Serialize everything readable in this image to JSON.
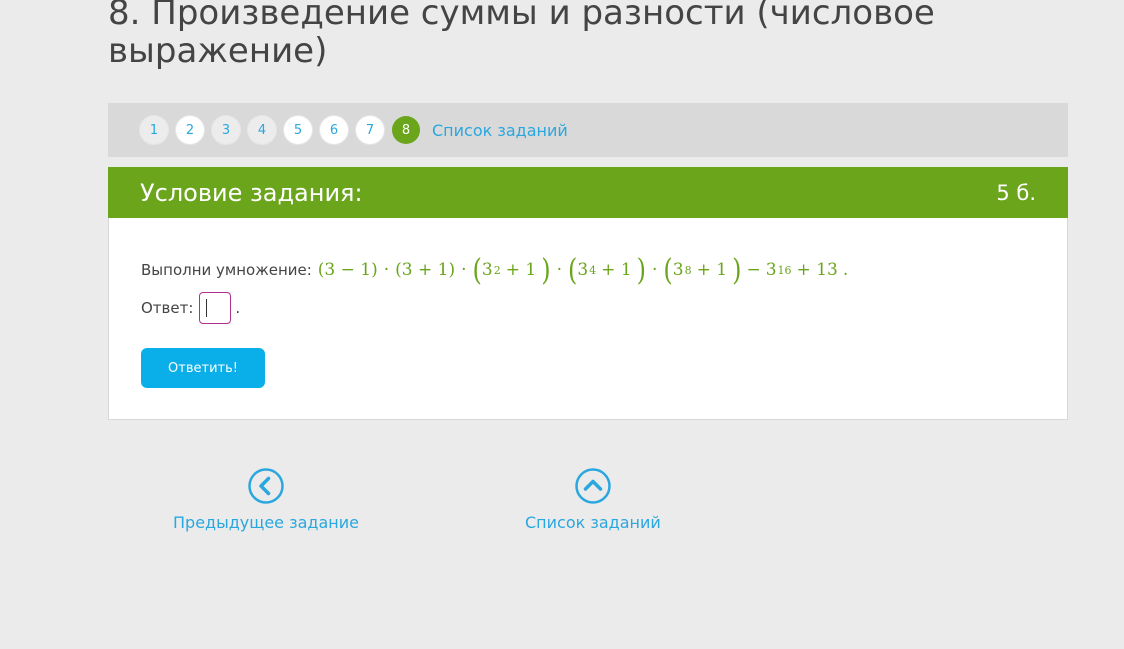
{
  "page": {
    "title": "8. Произведение суммы и разности (числовое выражение)"
  },
  "task_nav": {
    "numbers": [
      "1",
      "2",
      "3",
      "4",
      "5",
      "6",
      "7",
      "8"
    ],
    "active": "8",
    "list_label": "Список заданий"
  },
  "task": {
    "header_title": "Условие задания:",
    "points": "5 б.",
    "instruction": "Выполни умножение:",
    "expression": {
      "t1": "(3 − 1)",
      "t2": "(3 + 1)",
      "base": "3",
      "exp2": "2",
      "exp4": "4",
      "exp8": "8",
      "exp16": "16",
      "plus1": "+ 1",
      "minus": "−",
      "plus13": "+ 13",
      "dot": "·",
      "end": "."
    },
    "answer_label": "Ответ:",
    "answer_value": "",
    "answer_end": ".",
    "submit_label": "Ответить!"
  },
  "bottom_nav": {
    "prev_label": "Предыдущее задание",
    "list_label": "Список заданий"
  },
  "colors": {
    "accent_green": "#6aa51c",
    "link_blue": "#2aa7df",
    "button_blue": "#0aaee8"
  },
  "icons": {
    "prev": "chevron-left-circle-icon",
    "list": "chevron-up-circle-icon"
  }
}
